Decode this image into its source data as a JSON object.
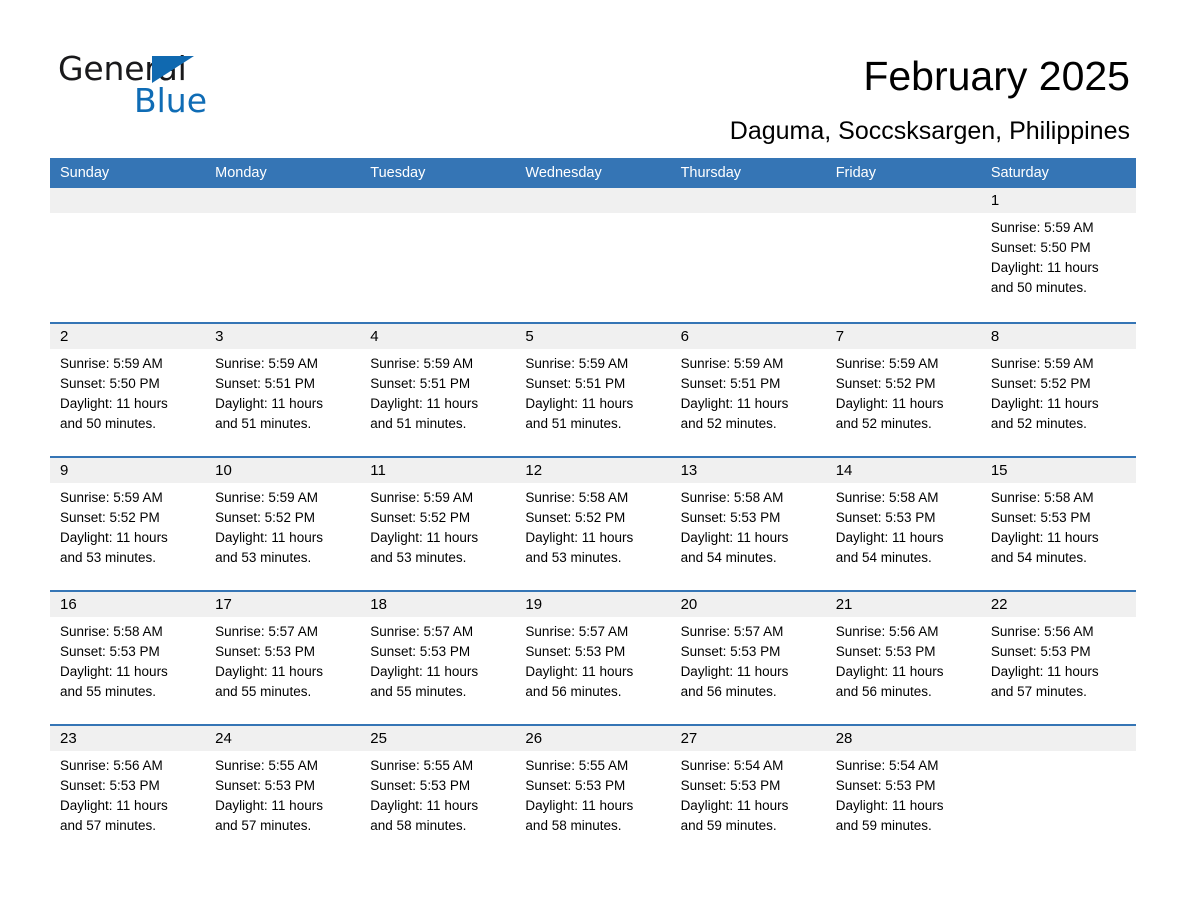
{
  "brand": {
    "name_part1": "General",
    "name_part2": "Blue",
    "triangle_color": "#1069b0",
    "blue_color": "#0f6cb5"
  },
  "header": {
    "title": "February 2025",
    "subtitle": "Daguma, Soccsksargen, Philippines"
  },
  "theme": {
    "header_bar_color": "#3575b5",
    "date_band_color": "#f0f0f0",
    "row_rule_color": "#3575b5",
    "text_color": "#000000"
  },
  "calendar": {
    "weekday_headers": [
      "Sunday",
      "Monday",
      "Tuesday",
      "Wednesday",
      "Thursday",
      "Friday",
      "Saturday"
    ],
    "weeks": [
      [
        {
          "day": "",
          "sunrise": "",
          "sunset": "",
          "daylight1": "",
          "daylight2": ""
        },
        {
          "day": "",
          "sunrise": "",
          "sunset": "",
          "daylight1": "",
          "daylight2": ""
        },
        {
          "day": "",
          "sunrise": "",
          "sunset": "",
          "daylight1": "",
          "daylight2": ""
        },
        {
          "day": "",
          "sunrise": "",
          "sunset": "",
          "daylight1": "",
          "daylight2": ""
        },
        {
          "day": "",
          "sunrise": "",
          "sunset": "",
          "daylight1": "",
          "daylight2": ""
        },
        {
          "day": "",
          "sunrise": "",
          "sunset": "",
          "daylight1": "",
          "daylight2": ""
        },
        {
          "day": "1",
          "sunrise": "Sunrise: 5:59 AM",
          "sunset": "Sunset: 5:50 PM",
          "daylight1": "Daylight: 11 hours",
          "daylight2": "and 50 minutes."
        }
      ],
      [
        {
          "day": "2",
          "sunrise": "Sunrise: 5:59 AM",
          "sunset": "Sunset: 5:50 PM",
          "daylight1": "Daylight: 11 hours",
          "daylight2": "and 50 minutes."
        },
        {
          "day": "3",
          "sunrise": "Sunrise: 5:59 AM",
          "sunset": "Sunset: 5:51 PM",
          "daylight1": "Daylight: 11 hours",
          "daylight2": "and 51 minutes."
        },
        {
          "day": "4",
          "sunrise": "Sunrise: 5:59 AM",
          "sunset": "Sunset: 5:51 PM",
          "daylight1": "Daylight: 11 hours",
          "daylight2": "and 51 minutes."
        },
        {
          "day": "5",
          "sunrise": "Sunrise: 5:59 AM",
          "sunset": "Sunset: 5:51 PM",
          "daylight1": "Daylight: 11 hours",
          "daylight2": "and 51 minutes."
        },
        {
          "day": "6",
          "sunrise": "Sunrise: 5:59 AM",
          "sunset": "Sunset: 5:51 PM",
          "daylight1": "Daylight: 11 hours",
          "daylight2": "and 52 minutes."
        },
        {
          "day": "7",
          "sunrise": "Sunrise: 5:59 AM",
          "sunset": "Sunset: 5:52 PM",
          "daylight1": "Daylight: 11 hours",
          "daylight2": "and 52 minutes."
        },
        {
          "day": "8",
          "sunrise": "Sunrise: 5:59 AM",
          "sunset": "Sunset: 5:52 PM",
          "daylight1": "Daylight: 11 hours",
          "daylight2": "and 52 minutes."
        }
      ],
      [
        {
          "day": "9",
          "sunrise": "Sunrise: 5:59 AM",
          "sunset": "Sunset: 5:52 PM",
          "daylight1": "Daylight: 11 hours",
          "daylight2": "and 53 minutes."
        },
        {
          "day": "10",
          "sunrise": "Sunrise: 5:59 AM",
          "sunset": "Sunset: 5:52 PM",
          "daylight1": "Daylight: 11 hours",
          "daylight2": "and 53 minutes."
        },
        {
          "day": "11",
          "sunrise": "Sunrise: 5:59 AM",
          "sunset": "Sunset: 5:52 PM",
          "daylight1": "Daylight: 11 hours",
          "daylight2": "and 53 minutes."
        },
        {
          "day": "12",
          "sunrise": "Sunrise: 5:58 AM",
          "sunset": "Sunset: 5:52 PM",
          "daylight1": "Daylight: 11 hours",
          "daylight2": "and 53 minutes."
        },
        {
          "day": "13",
          "sunrise": "Sunrise: 5:58 AM",
          "sunset": "Sunset: 5:53 PM",
          "daylight1": "Daylight: 11 hours",
          "daylight2": "and 54 minutes."
        },
        {
          "day": "14",
          "sunrise": "Sunrise: 5:58 AM",
          "sunset": "Sunset: 5:53 PM",
          "daylight1": "Daylight: 11 hours",
          "daylight2": "and 54 minutes."
        },
        {
          "day": "15",
          "sunrise": "Sunrise: 5:58 AM",
          "sunset": "Sunset: 5:53 PM",
          "daylight1": "Daylight: 11 hours",
          "daylight2": "and 54 minutes."
        }
      ],
      [
        {
          "day": "16",
          "sunrise": "Sunrise: 5:58 AM",
          "sunset": "Sunset: 5:53 PM",
          "daylight1": "Daylight: 11 hours",
          "daylight2": "and 55 minutes."
        },
        {
          "day": "17",
          "sunrise": "Sunrise: 5:57 AM",
          "sunset": "Sunset: 5:53 PM",
          "daylight1": "Daylight: 11 hours",
          "daylight2": "and 55 minutes."
        },
        {
          "day": "18",
          "sunrise": "Sunrise: 5:57 AM",
          "sunset": "Sunset: 5:53 PM",
          "daylight1": "Daylight: 11 hours",
          "daylight2": "and 55 minutes."
        },
        {
          "day": "19",
          "sunrise": "Sunrise: 5:57 AM",
          "sunset": "Sunset: 5:53 PM",
          "daylight1": "Daylight: 11 hours",
          "daylight2": "and 56 minutes."
        },
        {
          "day": "20",
          "sunrise": "Sunrise: 5:57 AM",
          "sunset": "Sunset: 5:53 PM",
          "daylight1": "Daylight: 11 hours",
          "daylight2": "and 56 minutes."
        },
        {
          "day": "21",
          "sunrise": "Sunrise: 5:56 AM",
          "sunset": "Sunset: 5:53 PM",
          "daylight1": "Daylight: 11 hours",
          "daylight2": "and 56 minutes."
        },
        {
          "day": "22",
          "sunrise": "Sunrise: 5:56 AM",
          "sunset": "Sunset: 5:53 PM",
          "daylight1": "Daylight: 11 hours",
          "daylight2": "and 57 minutes."
        }
      ],
      [
        {
          "day": "23",
          "sunrise": "Sunrise: 5:56 AM",
          "sunset": "Sunset: 5:53 PM",
          "daylight1": "Daylight: 11 hours",
          "daylight2": "and 57 minutes."
        },
        {
          "day": "24",
          "sunrise": "Sunrise: 5:55 AM",
          "sunset": "Sunset: 5:53 PM",
          "daylight1": "Daylight: 11 hours",
          "daylight2": "and 57 minutes."
        },
        {
          "day": "25",
          "sunrise": "Sunrise: 5:55 AM",
          "sunset": "Sunset: 5:53 PM",
          "daylight1": "Daylight: 11 hours",
          "daylight2": "and 58 minutes."
        },
        {
          "day": "26",
          "sunrise": "Sunrise: 5:55 AM",
          "sunset": "Sunset: 5:53 PM",
          "daylight1": "Daylight: 11 hours",
          "daylight2": "and 58 minutes."
        },
        {
          "day": "27",
          "sunrise": "Sunrise: 5:54 AM",
          "sunset": "Sunset: 5:53 PM",
          "daylight1": "Daylight: 11 hours",
          "daylight2": "and 59 minutes."
        },
        {
          "day": "28",
          "sunrise": "Sunrise: 5:54 AM",
          "sunset": "Sunset: 5:53 PM",
          "daylight1": "Daylight: 11 hours",
          "daylight2": "and 59 minutes."
        },
        {
          "day": "",
          "sunrise": "",
          "sunset": "",
          "daylight1": "",
          "daylight2": ""
        }
      ]
    ]
  }
}
